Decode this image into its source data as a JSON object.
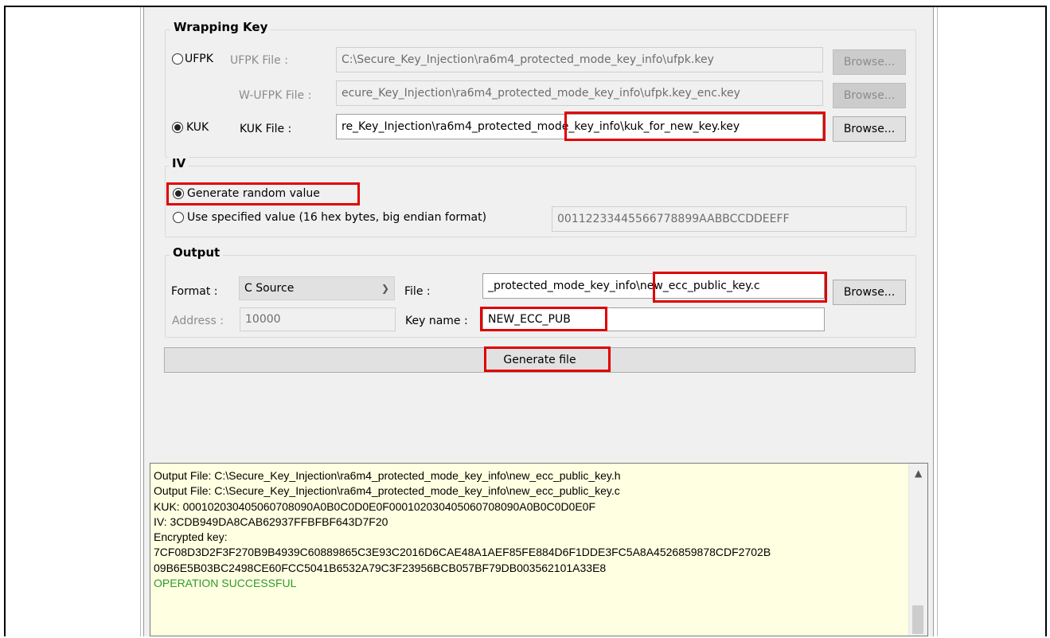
{
  "wrapping_key": {
    "title": "Wrapping Key",
    "ufpk": {
      "radio_label": "UFPK",
      "ufpk_file_label": "UFPK File :",
      "ufpk_file_value": "C:\\Secure_Key_Injection\\ra6m4_protected_mode_key_info\\ufpk.key",
      "wufpk_file_label": "W-UFPK File :",
      "wufpk_file_value": "ecure_Key_Injection\\ra6m4_protected_mode_key_info\\ufpk.key_enc.key",
      "browse_label": "Browse...",
      "selected": false
    },
    "kuk": {
      "radio_label": "KUK",
      "file_label": "KUK File :",
      "file_value": "re_Key_Injection\\ra6m4_protected_mode_key_info\\kuk_for_new_key.key",
      "browse_label": "Browse...",
      "selected": true
    }
  },
  "iv": {
    "title": "IV",
    "random_label": "Generate random value",
    "random_selected": true,
    "specified_label": "Use specified value (16 hex bytes, big endian format)",
    "specified_value": "00112233445566778899AABBCCDDEEFF"
  },
  "output": {
    "title": "Output",
    "format_label": "Format :",
    "format_value": "C Source",
    "file_label": "File :",
    "file_value": "_protected_mode_key_info\\new_ecc_public_key.c",
    "browse_label": "Browse...",
    "address_label": "Address :",
    "address_value": "10000",
    "key_name_label": "Key name :",
    "key_name_value": "NEW_ECC_PUB",
    "generate_label": "Generate file"
  },
  "log": {
    "lines": [
      "Output File: C:\\Secure_Key_Injection\\ra6m4_protected_mode_key_info\\new_ecc_public_key.h",
      "Output File: C:\\Secure_Key_Injection\\ra6m4_protected_mode_key_info\\new_ecc_public_key.c",
      "KUK: 000102030405060708090A0B0C0D0E0F000102030405060708090A0B0C0D0E0F",
      "IV: 3CDB949DA8CAB62937FFBFBF643D7F20",
      "Encrypted key:",
      "7CF08D3D2F3F270B9B4939C60889865C3E93C2016D6CAE48A1AEF85FE884D6F1DDE3FC5A8A4526859878CDF2702B",
      "09B6E5B03BC2498CE60FCC5041B6532A79C3F23956BCB057BF79DB003562101A33E8"
    ],
    "status": "OPERATION SUCCESSFUL"
  },
  "colors": {
    "highlight": "#e00000",
    "log_background": "#ffffe1",
    "success_text": "#2e9b2e"
  }
}
